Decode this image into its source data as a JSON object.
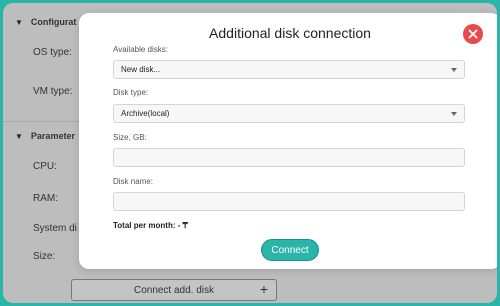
{
  "background": {
    "sections": [
      {
        "title": "Configurat"
      },
      {
        "title": "Parameter"
      }
    ],
    "labels": {
      "os_type": "OS type:",
      "vm_type": "VM type:",
      "cpu": "CPU:",
      "ram": "RAM:",
      "system_disk": "System di",
      "size": "Size:"
    },
    "connect_add_disk": "Connect add. disk",
    "plus": "+"
  },
  "modal": {
    "title": "Additional disk connection",
    "available_disks": {
      "label": "Available disks:",
      "value": "New disk..."
    },
    "disk_type": {
      "label": "Disk type:",
      "value": "Archive(local)"
    },
    "size": {
      "label": "Size, GB:",
      "value": ""
    },
    "disk_name": {
      "label": "Disk name:",
      "value": ""
    },
    "total": "Total per month: - ₸",
    "connect_button": "Connect"
  },
  "colors": {
    "accent": "#2ab5aa",
    "close": "#e84949"
  }
}
